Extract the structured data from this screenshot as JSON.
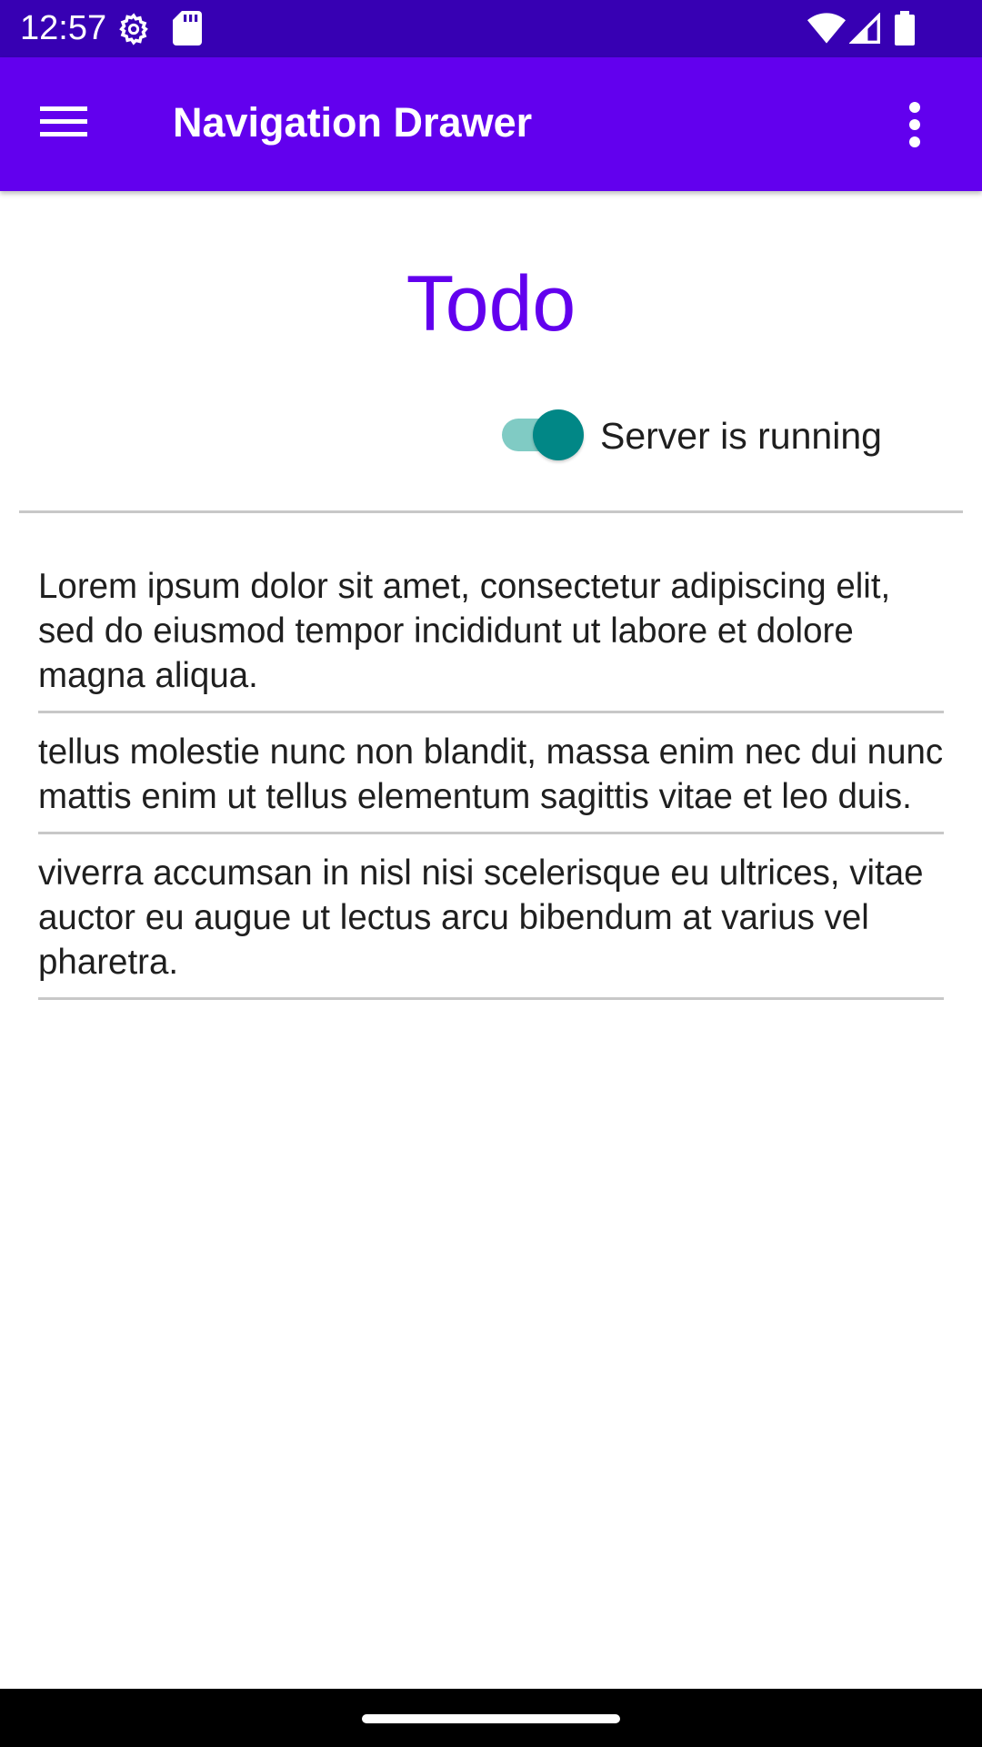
{
  "status_bar": {
    "time": "12:57",
    "left_icons": [
      "settings-icon",
      "sd-card-icon"
    ],
    "right_icons": [
      "wifi-icon",
      "cell-signal-icon",
      "battery-icon"
    ]
  },
  "app_bar": {
    "title": "Navigation Drawer",
    "navigation_icon": "menu-icon",
    "overflow_icon": "more-vert-icon",
    "background_color": "#6200ee"
  },
  "main": {
    "title": "Todo",
    "server_switch": {
      "label": "Server is running",
      "checked": true
    },
    "todos": [
      {
        "text": "Lorem ipsum dolor sit amet, consectetur adipiscing elit, sed do eiusmod tempor incididunt ut labore et dolore magna aliqua."
      },
      {
        "text": "tellus molestie nunc non blandit, massa enim nec dui nunc mattis enim ut tellus elementum sagittis vitae et leo duis."
      },
      {
        "text": "viverra accumsan in nisl nisi scelerisque eu ultrices, vitae auctor eu augue ut lectus arcu bibendum at varius vel pharetra."
      }
    ]
  },
  "colors": {
    "status_bar": "#3700b3",
    "primary": "#6200ee",
    "switch_thumb": "#018786",
    "switch_track": "#80cbc4"
  }
}
